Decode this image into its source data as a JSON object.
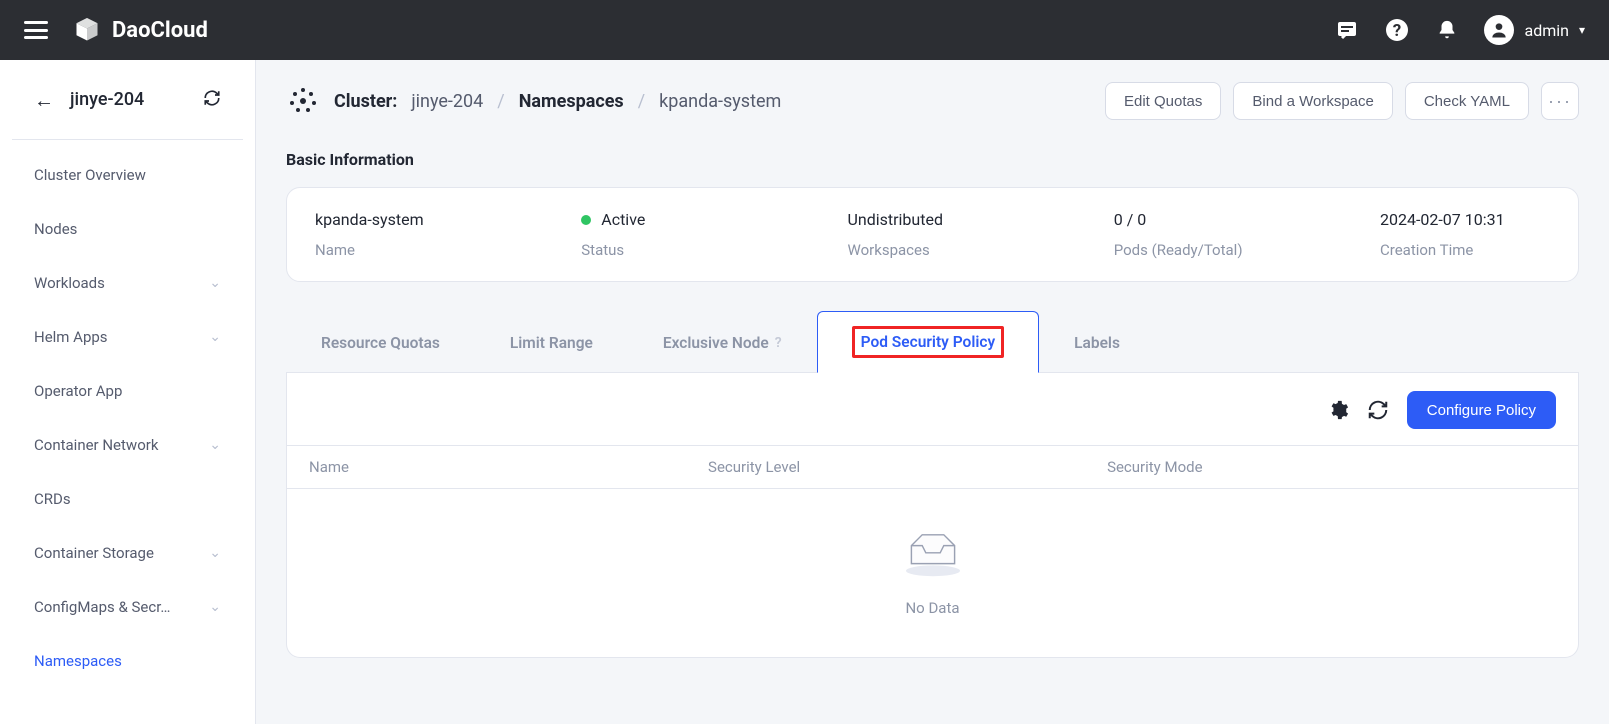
{
  "topbar": {
    "brand": "DaoCloud",
    "user": "admin"
  },
  "sidebar": {
    "title": "jinye-204",
    "items": [
      {
        "label": "Cluster Overview",
        "expandable": false
      },
      {
        "label": "Nodes",
        "expandable": false
      },
      {
        "label": "Workloads",
        "expandable": true
      },
      {
        "label": "Helm Apps",
        "expandable": true
      },
      {
        "label": "Operator App",
        "expandable": false
      },
      {
        "label": "Container Network",
        "expandable": true
      },
      {
        "label": "CRDs",
        "expandable": false
      },
      {
        "label": "Container Storage",
        "expandable": true
      },
      {
        "label": "ConfigMaps & Secr…",
        "expandable": true
      },
      {
        "label": "Namespaces",
        "expandable": false,
        "active": true
      }
    ]
  },
  "breadcrumb": {
    "prefix": "Cluster:",
    "cluster": "jinye-204",
    "section": "Namespaces",
    "item": "kpanda-system"
  },
  "actions": {
    "edit_quotas": "Edit Quotas",
    "bind_workspace": "Bind a Workspace",
    "check_yaml": "Check YAML"
  },
  "basic_info_title": "Basic Information",
  "info": {
    "name_val": "kpanda-system",
    "name_label": "Name",
    "status_val": "Active",
    "status_label": "Status",
    "workspaces_val": "Undistributed",
    "workspaces_label": "Workspaces",
    "pods_val": "0 / 0",
    "pods_label": "Pods (Ready/Total)",
    "time_val": "2024-02-07 10:31",
    "time_label": "Creation Time"
  },
  "tabs": {
    "quotas": "Resource Quotas",
    "limit": "Limit Range",
    "exclusive": "Exclusive Node",
    "psp": "Pod Security Policy",
    "labels": "Labels"
  },
  "panel": {
    "configure": "Configure Policy",
    "col_name": "Name",
    "col_level": "Security Level",
    "col_mode": "Security Mode",
    "empty": "No Data"
  }
}
